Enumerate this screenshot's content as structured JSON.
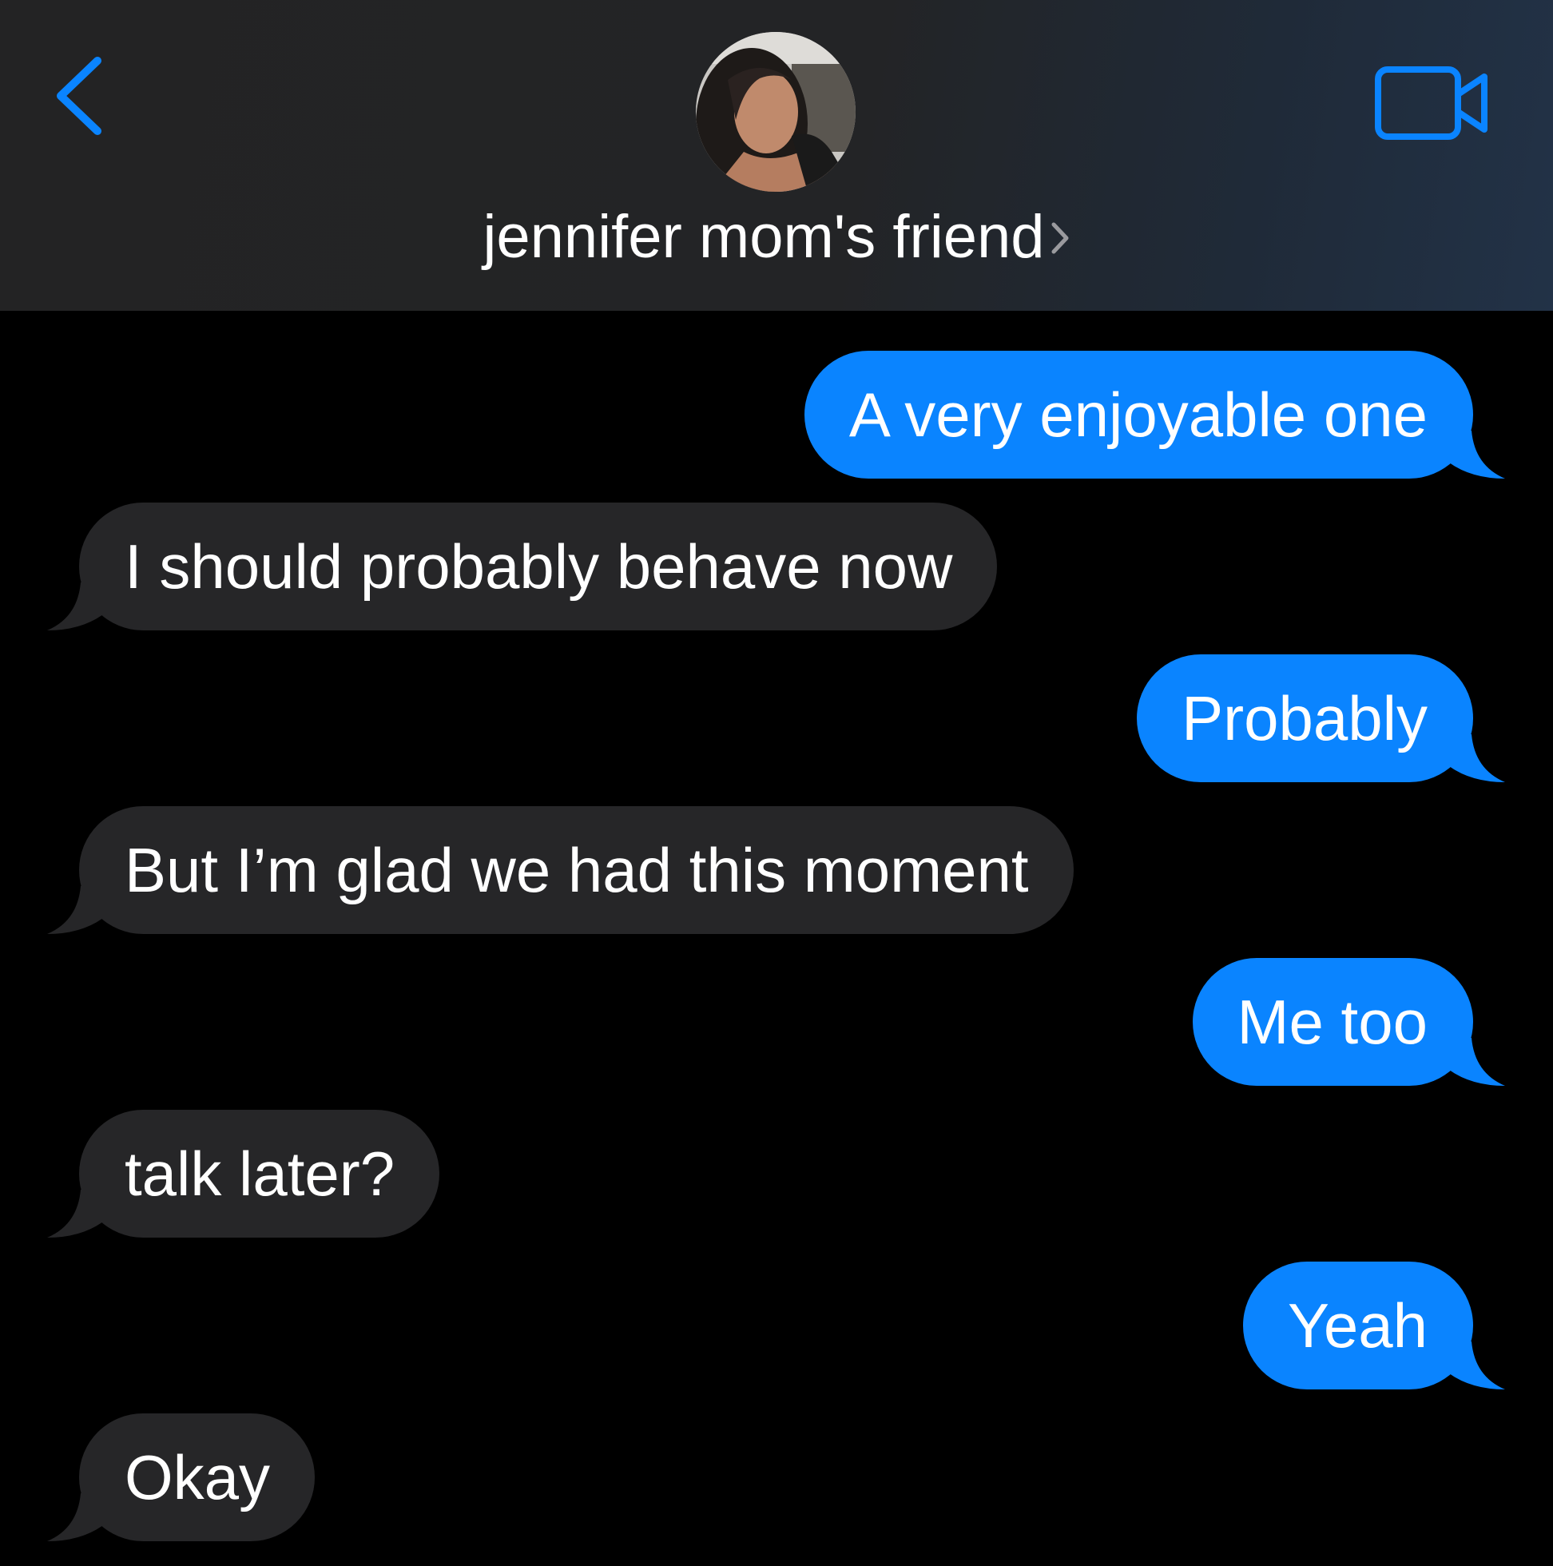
{
  "colors": {
    "accent": "#0a84ff",
    "incoming_bubble": "#262628",
    "background": "#000000",
    "header_background": "#232324",
    "text": "#ffffff"
  },
  "header": {
    "back_icon": "chevron-left-icon",
    "contact_name": "jennifer mom's friend",
    "contact_chevron_icon": "chevron-right-icon",
    "video_icon": "video-camera-icon",
    "avatar": "contact-avatar-photo"
  },
  "messages": [
    {
      "direction": "outgoing",
      "text": "A very enjoyable one"
    },
    {
      "direction": "incoming",
      "text": "I should probably behave now"
    },
    {
      "direction": "outgoing",
      "text": "Probably"
    },
    {
      "direction": "incoming",
      "text": "But I’m glad we had this moment"
    },
    {
      "direction": "outgoing",
      "text": "Me too"
    },
    {
      "direction": "incoming",
      "text": "talk later?"
    },
    {
      "direction": "outgoing",
      "text": "Yeah"
    },
    {
      "direction": "incoming",
      "text": "Okay"
    }
  ]
}
